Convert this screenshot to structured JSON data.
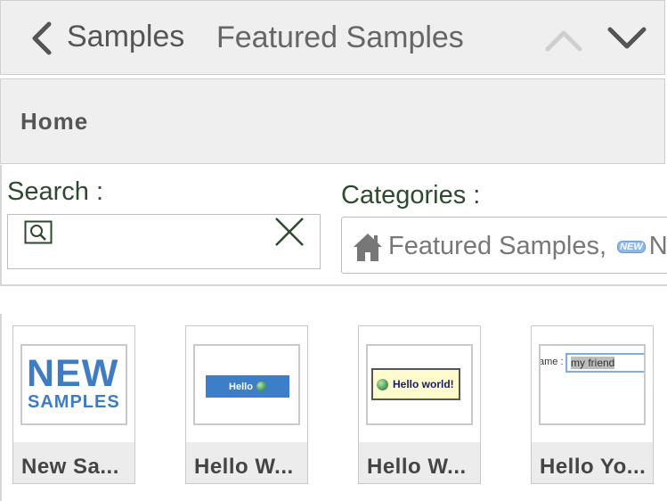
{
  "nav": {
    "back_label": "Samples",
    "title": "Featured Samples"
  },
  "breadcrumb": {
    "home_label": "Home"
  },
  "filters": {
    "search_caption": "Search :",
    "search_value": "",
    "categories_caption": "Categories :",
    "categories_value": "Featured Samples,",
    "categories_more": "N...",
    "new_badge": "NEW"
  },
  "tiles": [
    {
      "caption": "New Sa...",
      "thumb_big": "NEW",
      "thumb_small": "SAMPLES"
    },
    {
      "caption": "Hello W...",
      "thumb_text": "Hello"
    },
    {
      "caption": "Hello W...",
      "thumb_text": "Hello world!"
    },
    {
      "caption": "Hello Yo...",
      "thumb_label": "ame :",
      "thumb_input": "my friend"
    }
  ],
  "colors": {
    "bar_bg": "#efefef",
    "caption_green": "#2e4a2e",
    "accent_blue": "#3e7cc4"
  }
}
